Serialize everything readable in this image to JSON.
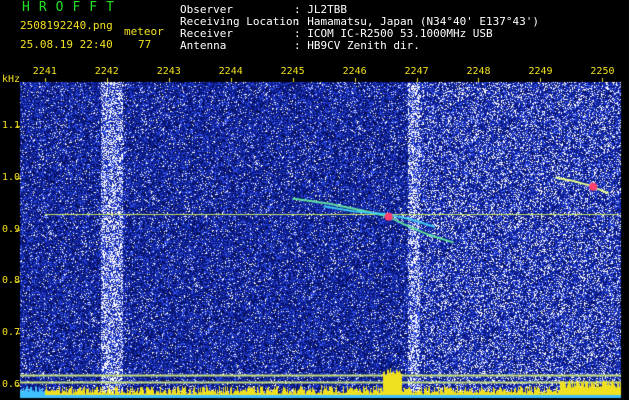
{
  "header": {
    "app_title": "HROFFT",
    "filename": "2508192240.png",
    "event_type": "meteor",
    "datetime": "25.08.19 22:40",
    "count": "77"
  },
  "station": {
    "labels": [
      "Observer",
      "Receiving Location",
      "Receiver",
      "Antenna"
    ],
    "values": [
      ": JL2TBB",
      ": Hamamatsu, Japan (N34°40' E137°43')",
      ": ICOM IC-R2500 53.1000MHz USB",
      ": HB9CV Zenith dir."
    ]
  },
  "colors": {
    "background": "#000000",
    "noise_field": "#0a1a8a",
    "label_yellow": "#f0e020",
    "title_green": "#22e022",
    "reference_line": "#c8e060"
  },
  "chart_data": {
    "type": "spectrogram",
    "y_unit": "kHz",
    "x_ticks": [
      "2241",
      "2242",
      "2243",
      "2244",
      "2245",
      "2246",
      "2247",
      "2248",
      "2249",
      "2250"
    ],
    "y_ticks": [
      "1.1",
      "1.0",
      "0.9",
      "0.8",
      "0.7",
      "0.6"
    ],
    "x_tick_values": [
      2241,
      2242,
      2243,
      2244,
      2245,
      2246,
      2247,
      2248,
      2249,
      2250
    ],
    "y_tick_values": [
      1.1,
      1.0,
      0.9,
      0.8,
      0.7,
      0.6
    ],
    "reference_tone_khz": 0.93,
    "meteor_traces": [
      {
        "name": "",
        "points": [
          [
            2245.0,
            0.96
          ],
          [
            2245.6,
            0.95
          ],
          [
            2246.2,
            0.935
          ],
          [
            2246.55,
            0.925
          ],
          [
            2246.8,
            0.91
          ],
          [
            2247.2,
            0.89
          ],
          [
            2247.6,
            0.875
          ]
        ]
      },
      {
        "name": "",
        "points": [
          [
            2245.5,
            0.945
          ],
          [
            2246.0,
            0.935
          ],
          [
            2246.5,
            0.93
          ],
          [
            2246.9,
            0.92
          ],
          [
            2247.3,
            0.905
          ]
        ]
      },
      {
        "name": "",
        "points": [
          [
            2249.25,
            1.0
          ],
          [
            2249.5,
            0.995
          ],
          [
            2249.8,
            0.985
          ],
          [
            2250.1,
            0.97
          ]
        ]
      }
    ],
    "bright_vertical_bands": [
      [
        2241.9,
        2242.25
      ],
      [
        2246.85,
        2247.05
      ]
    ],
    "bottom_level_lines_khz": [
      0.62,
      0.605
    ]
  }
}
